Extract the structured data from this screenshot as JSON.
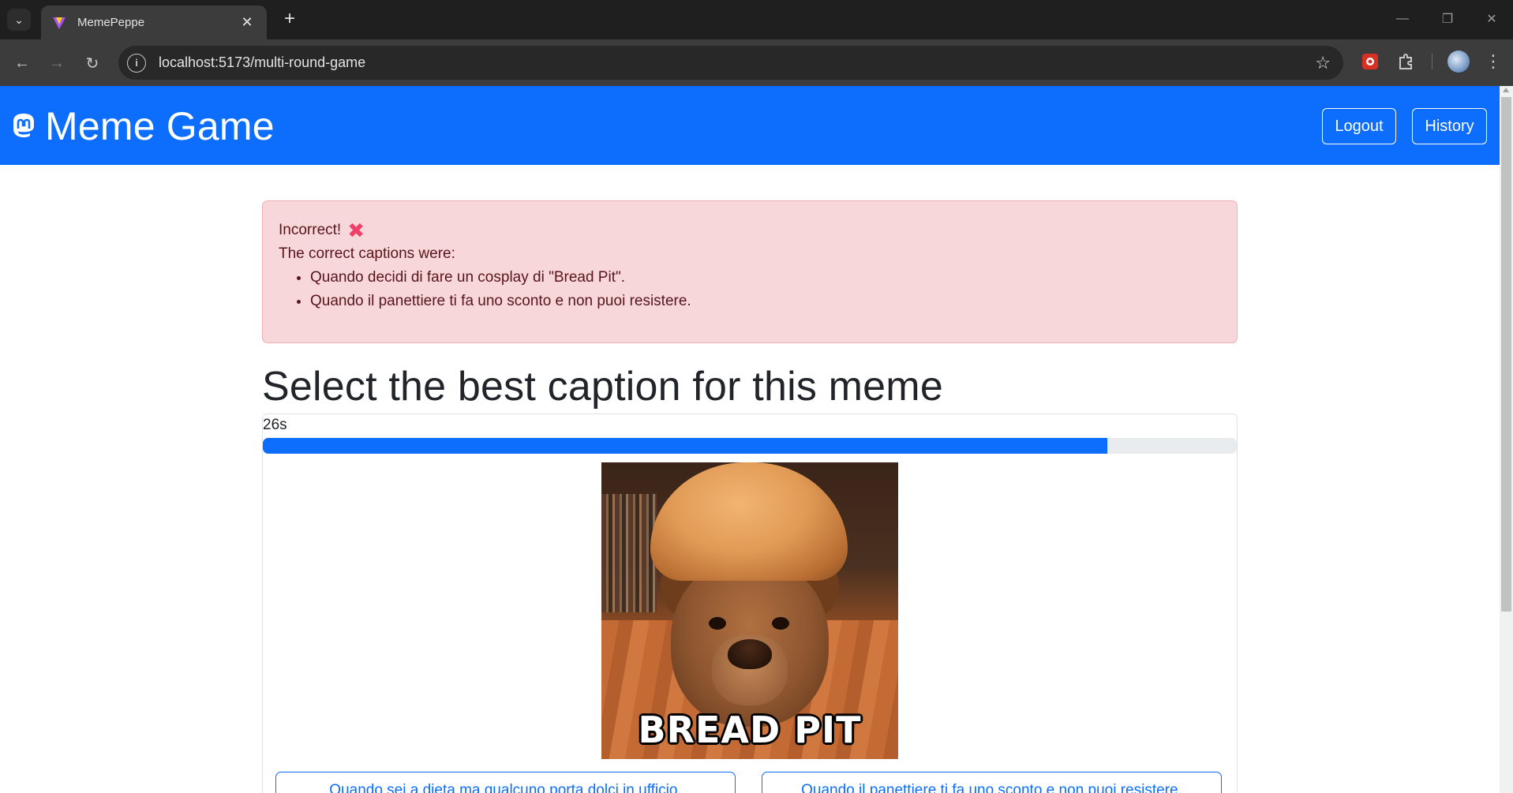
{
  "browser": {
    "tab_title": "MemePeppe",
    "url": "localhost:5173/multi-round-game"
  },
  "navbar": {
    "brand": "Meme Game",
    "logout_label": "Logout",
    "history_label": "History",
    "color": "#0d6efd"
  },
  "alert": {
    "status": "Incorrect!",
    "status_icon": "cross-mark-icon",
    "intro": "The correct captions were:",
    "correct_captions": [
      "Quando decidi di fare un cosplay di \"Bread Pit\".",
      "Quando il panettiere ti fa uno sconto e non puoi resistere."
    ]
  },
  "game": {
    "heading": "Select the best caption for this meme",
    "timer_label": "26s",
    "timer_progress_percent": 86.7,
    "meme_image_text": "BREAD PIT",
    "caption_options": [
      "Quando sei a dieta ma qualcuno porta dolci in ufficio.",
      "Quando il panettiere ti fa uno sconto e non puoi resistere."
    ]
  }
}
